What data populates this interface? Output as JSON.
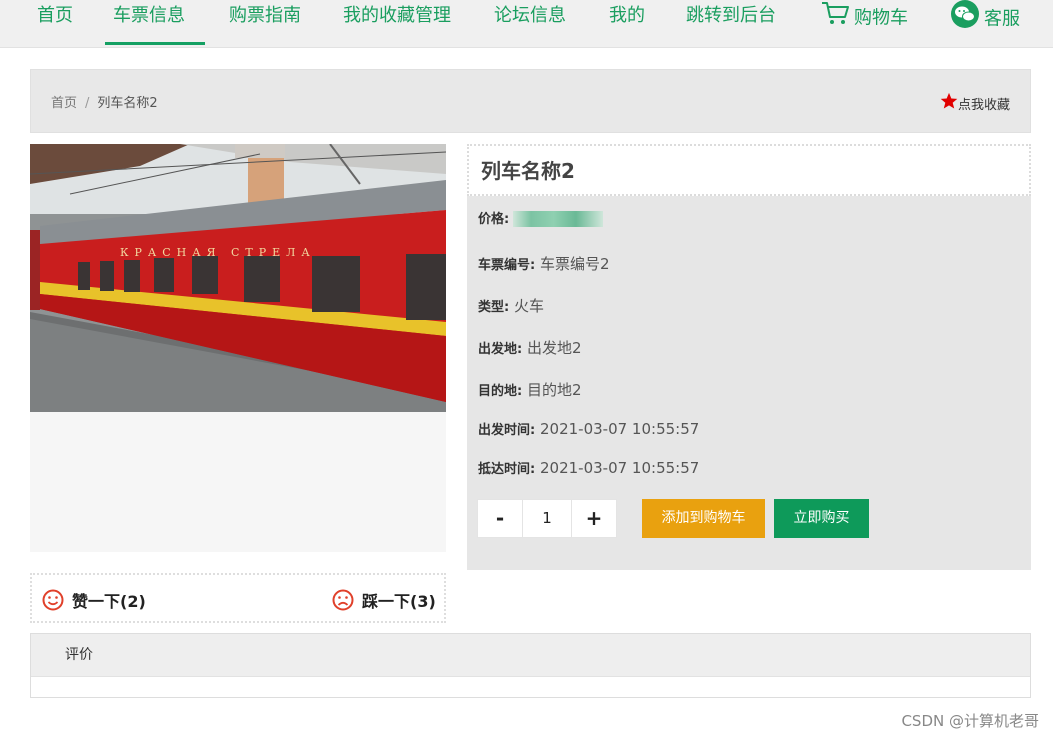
{
  "nav": {
    "items": [
      {
        "label": "首页"
      },
      {
        "label": "车票信息"
      },
      {
        "label": "购票指南"
      },
      {
        "label": "我的收藏管理"
      },
      {
        "label": "论坛信息"
      },
      {
        "label": "我的"
      },
      {
        "label": "跳转到后台"
      },
      {
        "label": "购物车",
        "icon": "cart-icon"
      },
      {
        "label": "客服",
        "icon": "wechat-icon"
      }
    ],
    "active_index": 1,
    "accent_color": "#1a9e5f"
  },
  "breadcrumb": {
    "home": "首页",
    "separator": "/",
    "current": "列车名称2"
  },
  "favorite": {
    "label": "点我收藏",
    "icon": "star-icon",
    "icon_color": "#e10000"
  },
  "product": {
    "image_alt_icon": "train-photo",
    "title": "列车名称2",
    "fields": [
      {
        "label": "价格:",
        "value": ""
      },
      {
        "label": "车票编号:",
        "value": "车票编号2"
      },
      {
        "label": "类型:",
        "value": "火车"
      },
      {
        "label": "出发地:",
        "value": "出发地2"
      },
      {
        "label": "目的地:",
        "value": "目的地2"
      },
      {
        "label": "出发时间:",
        "value": "2021-03-07 10:55:57"
      },
      {
        "label": "抵达时间:",
        "value": "2021-03-07 10:55:57"
      }
    ],
    "quantity": {
      "minus": "-",
      "value": "1",
      "plus": "+"
    },
    "add_to_cart": "添加到购物车",
    "buy_now": "立即购买",
    "add_to_cart_color": "#e9a10f",
    "buy_now_color": "#0e9a5a"
  },
  "votes": {
    "like": {
      "label": "赞一下(2)",
      "icon": "smile-icon"
    },
    "dislike": {
      "label": "踩一下(3)",
      "icon": "frown-icon"
    }
  },
  "comments": {
    "header": "评价"
  },
  "watermark": "CSDN @计算机老哥"
}
